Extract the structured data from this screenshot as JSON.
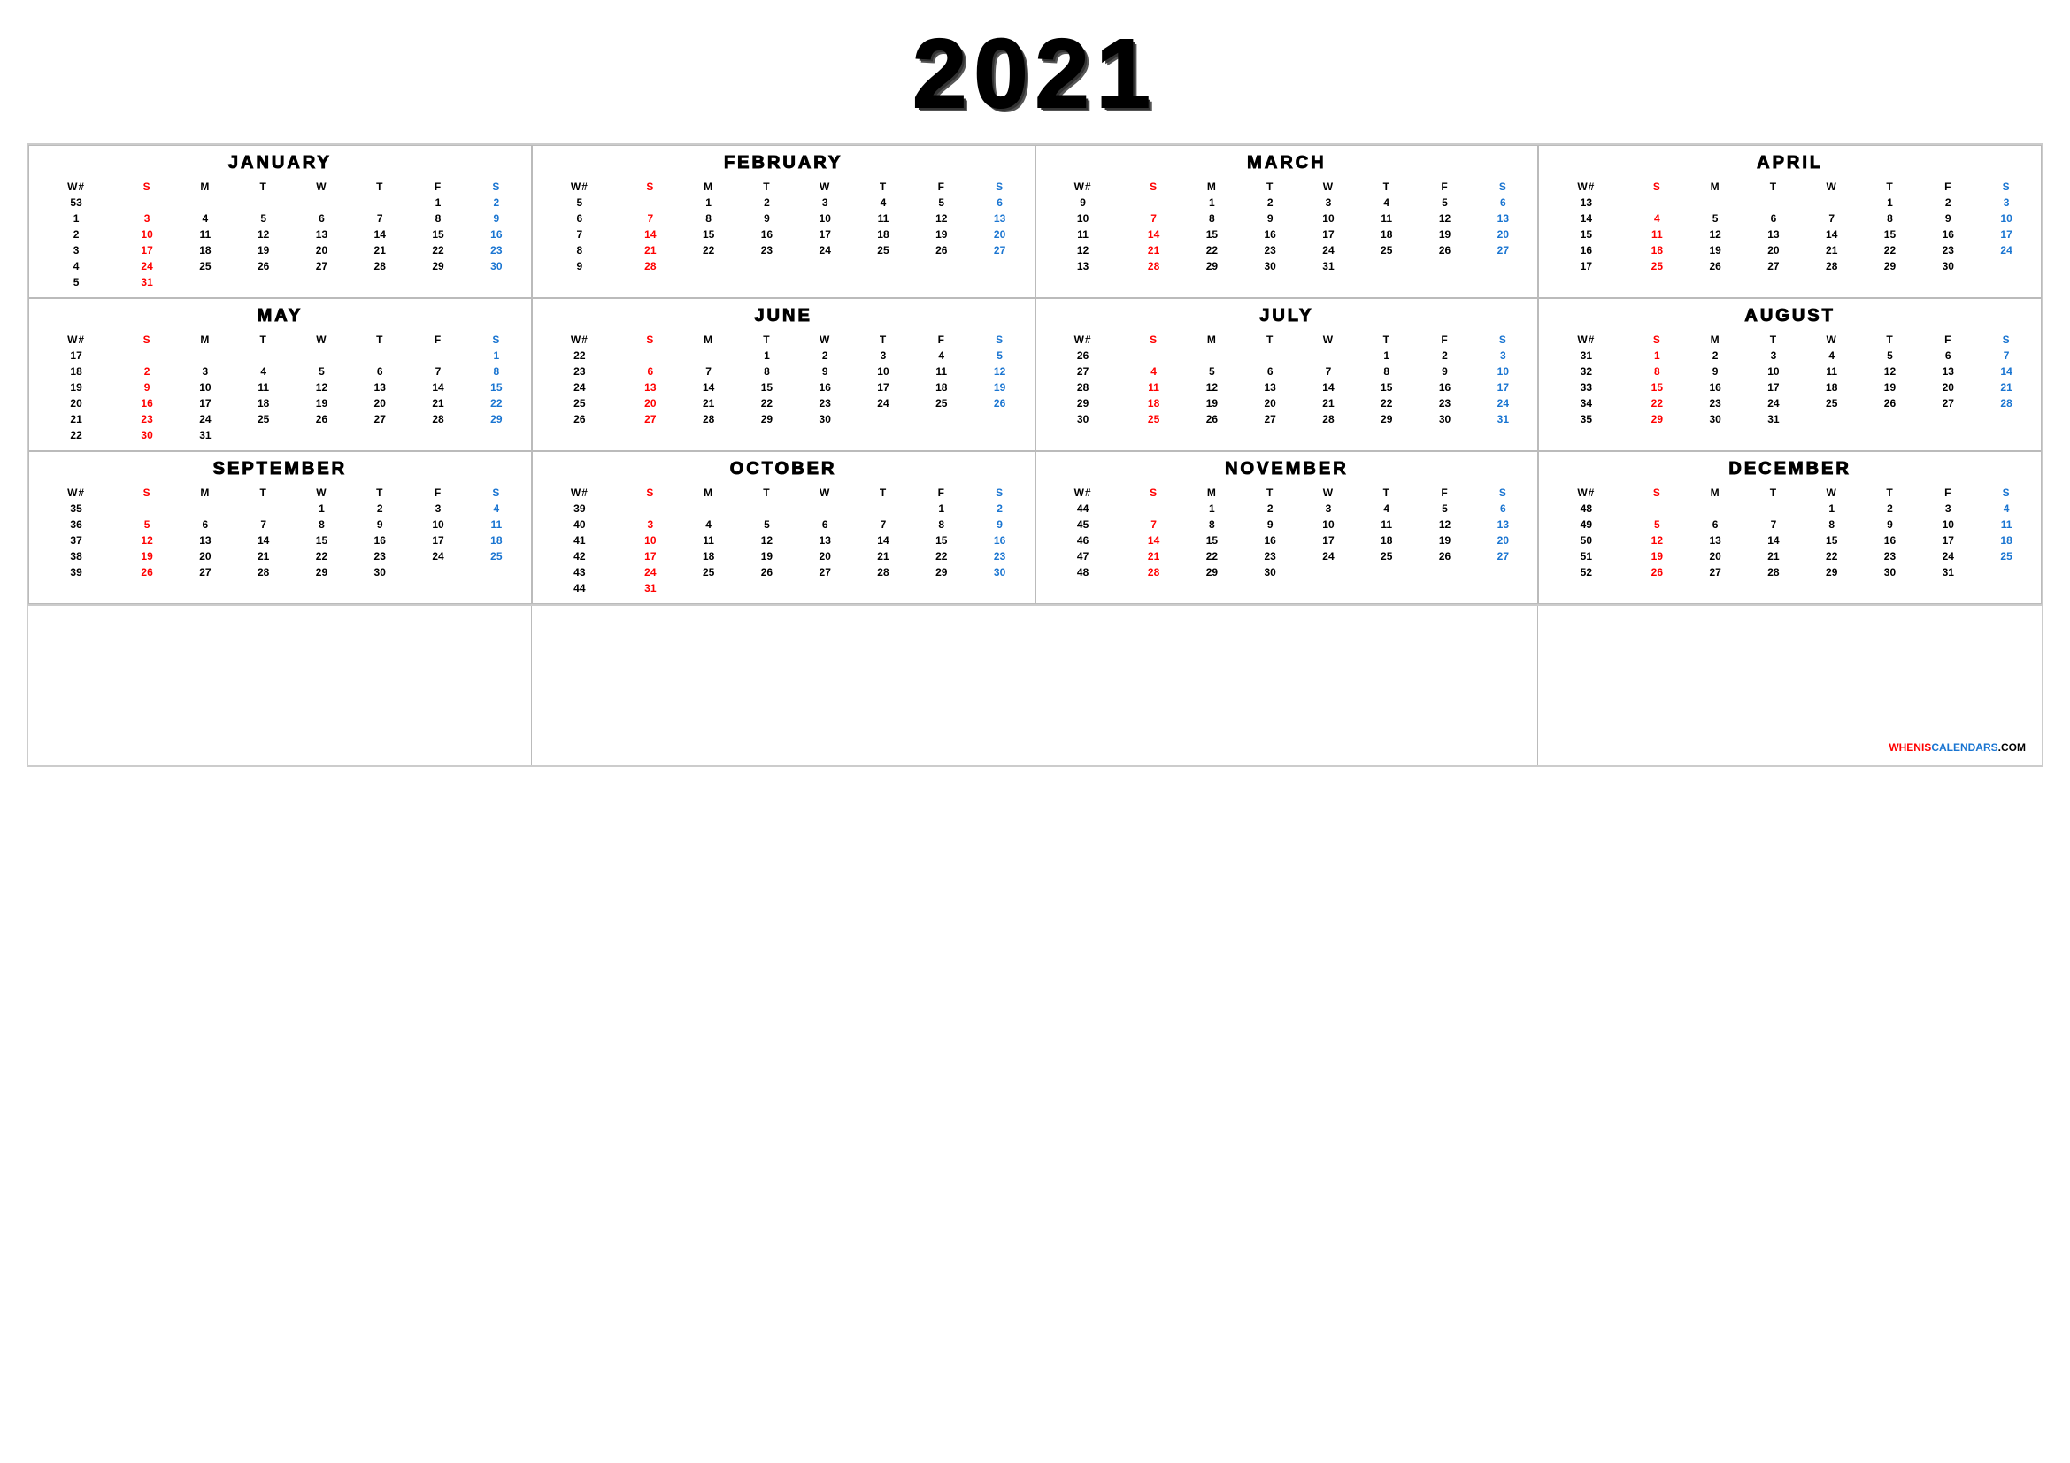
{
  "year": "2021",
  "months": [
    {
      "name": "JANUARY",
      "weeks": [
        {
          "wn": "53",
          "sun": "",
          "mon": "",
          "tue": "",
          "wed": "",
          "thu": "",
          "fri": "1",
          "sat": "2"
        },
        {
          "wn": "1",
          "sun": "3",
          "mon": "4",
          "tue": "5",
          "wed": "6",
          "thu": "7",
          "fri": "8",
          "sat": "9"
        },
        {
          "wn": "2",
          "sun": "10",
          "mon": "11",
          "tue": "12",
          "wed": "13",
          "thu": "14",
          "fri": "15",
          "sat": "16"
        },
        {
          "wn": "3",
          "sun": "17",
          "mon": "18",
          "tue": "19",
          "wed": "20",
          "thu": "21",
          "fri": "22",
          "sat": "23"
        },
        {
          "wn": "4",
          "sun": "24",
          "mon": "25",
          "tue": "26",
          "wed": "27",
          "thu": "28",
          "fri": "29",
          "sat": "30"
        },
        {
          "wn": "5",
          "sun": "31",
          "mon": "",
          "tue": "",
          "wed": "",
          "thu": "",
          "fri": "",
          "sat": ""
        }
      ]
    },
    {
      "name": "FEBRUARY",
      "weeks": [
        {
          "wn": "5",
          "sun": "",
          "mon": "1",
          "tue": "2",
          "wed": "3",
          "thu": "4",
          "fri": "5",
          "sat": "6"
        },
        {
          "wn": "6",
          "sun": "7",
          "mon": "8",
          "tue": "9",
          "wed": "10",
          "thu": "11",
          "fri": "12",
          "sat": "13"
        },
        {
          "wn": "7",
          "sun": "14",
          "mon": "15",
          "tue": "16",
          "wed": "17",
          "thu": "18",
          "fri": "19",
          "sat": "20"
        },
        {
          "wn": "8",
          "sun": "21",
          "mon": "22",
          "tue": "23",
          "wed": "24",
          "thu": "25",
          "fri": "26",
          "sat": "27"
        },
        {
          "wn": "9",
          "sun": "28",
          "mon": "",
          "tue": "",
          "wed": "",
          "thu": "",
          "fri": "",
          "sat": ""
        }
      ]
    },
    {
      "name": "MARCH",
      "weeks": [
        {
          "wn": "9",
          "sun": "",
          "mon": "1",
          "tue": "2",
          "wed": "3",
          "thu": "4",
          "fri": "5",
          "sat": "6"
        },
        {
          "wn": "10",
          "sun": "7",
          "mon": "8",
          "tue": "9",
          "wed": "10",
          "thu": "11",
          "fri": "12",
          "sat": "13"
        },
        {
          "wn": "11",
          "sun": "14",
          "mon": "15",
          "tue": "16",
          "wed": "17",
          "thu": "18",
          "fri": "19",
          "sat": "20"
        },
        {
          "wn": "12",
          "sun": "21",
          "mon": "22",
          "tue": "23",
          "wed": "24",
          "thu": "25",
          "fri": "26",
          "sat": "27"
        },
        {
          "wn": "13",
          "sun": "28",
          "mon": "29",
          "tue": "30",
          "wed": "31",
          "thu": "",
          "fri": "",
          "sat": ""
        }
      ]
    },
    {
      "name": "APRIL",
      "weeks": [
        {
          "wn": "13",
          "sun": "",
          "mon": "",
          "tue": "",
          "wed": "",
          "thu": "1",
          "fri": "2",
          "sat": "3"
        },
        {
          "wn": "14",
          "sun": "4",
          "mon": "5",
          "tue": "6",
          "wed": "7",
          "thu": "8",
          "fri": "9",
          "sat": "10"
        },
        {
          "wn": "15",
          "sun": "11",
          "mon": "12",
          "tue": "13",
          "wed": "14",
          "thu": "15",
          "fri": "16",
          "sat": "17"
        },
        {
          "wn": "16",
          "sun": "18",
          "mon": "19",
          "tue": "20",
          "wed": "21",
          "thu": "22",
          "fri": "23",
          "sat": "24"
        },
        {
          "wn": "17",
          "sun": "25",
          "mon": "26",
          "tue": "27",
          "wed": "28",
          "thu": "29",
          "fri": "30",
          "sat": ""
        }
      ]
    },
    {
      "name": "MAY",
      "weeks": [
        {
          "wn": "17",
          "sun": "",
          "mon": "",
          "tue": "",
          "wed": "",
          "thu": "",
          "fri": "",
          "sat": "1"
        },
        {
          "wn": "18",
          "sun": "2",
          "mon": "3",
          "tue": "4",
          "wed": "5",
          "thu": "6",
          "fri": "7",
          "sat": "8"
        },
        {
          "wn": "19",
          "sun": "9",
          "mon": "10",
          "tue": "11",
          "wed": "12",
          "thu": "13",
          "fri": "14",
          "sat": "15"
        },
        {
          "wn": "20",
          "sun": "16",
          "mon": "17",
          "tue": "18",
          "wed": "19",
          "thu": "20",
          "fri": "21",
          "sat": "22"
        },
        {
          "wn": "21",
          "sun": "23",
          "mon": "24",
          "tue": "25",
          "wed": "26",
          "thu": "27",
          "fri": "28",
          "sat": "29"
        },
        {
          "wn": "22",
          "sun": "30",
          "mon": "31",
          "tue": "",
          "wed": "",
          "thu": "",
          "fri": "",
          "sat": ""
        }
      ]
    },
    {
      "name": "JUNE",
      "weeks": [
        {
          "wn": "22",
          "sun": "",
          "mon": "",
          "tue": "1",
          "wed": "2",
          "thu": "3",
          "fri": "4",
          "sat": "5"
        },
        {
          "wn": "23",
          "sun": "6",
          "mon": "7",
          "tue": "8",
          "wed": "9",
          "thu": "10",
          "fri": "11",
          "sat": "12"
        },
        {
          "wn": "24",
          "sun": "13",
          "mon": "14",
          "tue": "15",
          "wed": "16",
          "thu": "17",
          "fri": "18",
          "sat": "19"
        },
        {
          "wn": "25",
          "sun": "20",
          "mon": "21",
          "tue": "22",
          "wed": "23",
          "thu": "24",
          "fri": "25",
          "sat": "26"
        },
        {
          "wn": "26",
          "sun": "27",
          "mon": "28",
          "tue": "29",
          "wed": "30",
          "thu": "",
          "fri": "",
          "sat": ""
        }
      ]
    },
    {
      "name": "JULY",
      "weeks": [
        {
          "wn": "26",
          "sun": "",
          "mon": "",
          "tue": "",
          "wed": "",
          "thu": "1",
          "fri": "2",
          "sat": "3"
        },
        {
          "wn": "27",
          "sun": "4",
          "mon": "5",
          "tue": "6",
          "wed": "7",
          "thu": "8",
          "fri": "9",
          "sat": "10"
        },
        {
          "wn": "28",
          "sun": "11",
          "mon": "12",
          "tue": "13",
          "wed": "14",
          "thu": "15",
          "fri": "16",
          "sat": "17"
        },
        {
          "wn": "29",
          "sun": "18",
          "mon": "19",
          "tue": "20",
          "wed": "21",
          "thu": "22",
          "fri": "23",
          "sat": "24"
        },
        {
          "wn": "30",
          "sun": "25",
          "mon": "26",
          "tue": "27",
          "wed": "28",
          "thu": "29",
          "fri": "30",
          "sat": "31"
        }
      ]
    },
    {
      "name": "AUGUST",
      "weeks": [
        {
          "wn": "31",
          "sun": "1",
          "mon": "2",
          "tue": "3",
          "wed": "4",
          "thu": "5",
          "fri": "6",
          "sat": "7"
        },
        {
          "wn": "32",
          "sun": "8",
          "mon": "9",
          "tue": "10",
          "wed": "11",
          "thu": "12",
          "fri": "13",
          "sat": "14"
        },
        {
          "wn": "33",
          "sun": "15",
          "mon": "16",
          "tue": "17",
          "wed": "18",
          "thu": "19",
          "fri": "20",
          "sat": "21"
        },
        {
          "wn": "34",
          "sun": "22",
          "mon": "23",
          "tue": "24",
          "wed": "25",
          "thu": "26",
          "fri": "27",
          "sat": "28"
        },
        {
          "wn": "35",
          "sun": "29",
          "mon": "30",
          "tue": "31",
          "wed": "",
          "thu": "",
          "fri": "",
          "sat": ""
        }
      ]
    },
    {
      "name": "SEPTEMBER",
      "weeks": [
        {
          "wn": "35",
          "sun": "",
          "mon": "",
          "tue": "",
          "wed": "1",
          "thu": "2",
          "fri": "3",
          "sat": "4"
        },
        {
          "wn": "36",
          "sun": "5",
          "mon": "6",
          "tue": "7",
          "wed": "8",
          "thu": "9",
          "fri": "10",
          "sat": "11"
        },
        {
          "wn": "37",
          "sun": "12",
          "mon": "13",
          "tue": "14",
          "wed": "15",
          "thu": "16",
          "fri": "17",
          "sat": "18"
        },
        {
          "wn": "38",
          "sun": "19",
          "mon": "20",
          "tue": "21",
          "wed": "22",
          "thu": "23",
          "fri": "24",
          "sat": "25"
        },
        {
          "wn": "39",
          "sun": "26",
          "mon": "27",
          "tue": "28",
          "wed": "29",
          "thu": "30",
          "fri": "",
          "sat": ""
        }
      ]
    },
    {
      "name": "OCTOBER",
      "weeks": [
        {
          "wn": "39",
          "sun": "",
          "mon": "",
          "tue": "",
          "wed": "",
          "thu": "",
          "fri": "1",
          "sat": "2"
        },
        {
          "wn": "40",
          "sun": "3",
          "mon": "4",
          "tue": "5",
          "wed": "6",
          "thu": "7",
          "fri": "8",
          "sat": "9"
        },
        {
          "wn": "41",
          "sun": "10",
          "mon": "11",
          "tue": "12",
          "wed": "13",
          "thu": "14",
          "fri": "15",
          "sat": "16"
        },
        {
          "wn": "42",
          "sun": "17",
          "mon": "18",
          "tue": "19",
          "wed": "20",
          "thu": "21",
          "fri": "22",
          "sat": "23"
        },
        {
          "wn": "43",
          "sun": "24",
          "mon": "25",
          "tue": "26",
          "wed": "27",
          "thu": "28",
          "fri": "29",
          "sat": "30"
        },
        {
          "wn": "44",
          "sun": "31",
          "mon": "",
          "tue": "",
          "wed": "",
          "thu": "",
          "fri": "",
          "sat": ""
        }
      ]
    },
    {
      "name": "NOVEMBER",
      "weeks": [
        {
          "wn": "44",
          "sun": "",
          "mon": "1",
          "tue": "2",
          "wed": "3",
          "thu": "4",
          "fri": "5",
          "sat": "6"
        },
        {
          "wn": "45",
          "sun": "7",
          "mon": "8",
          "tue": "9",
          "wed": "10",
          "thu": "11",
          "fri": "12",
          "sat": "13"
        },
        {
          "wn": "46",
          "sun": "14",
          "mon": "15",
          "tue": "16",
          "wed": "17",
          "thu": "18",
          "fri": "19",
          "sat": "20"
        },
        {
          "wn": "47",
          "sun": "21",
          "mon": "22",
          "tue": "23",
          "wed": "24",
          "thu": "25",
          "fri": "26",
          "sat": "27"
        },
        {
          "wn": "48",
          "sun": "28",
          "mon": "29",
          "tue": "30",
          "wed": "",
          "thu": "",
          "fri": "",
          "sat": ""
        }
      ]
    },
    {
      "name": "DECEMBER",
      "weeks": [
        {
          "wn": "48",
          "sun": "",
          "mon": "",
          "tue": "",
          "wed": "1",
          "thu": "2",
          "fri": "3",
          "sat": "4"
        },
        {
          "wn": "49",
          "sun": "5",
          "mon": "6",
          "tue": "7",
          "wed": "8",
          "thu": "9",
          "fri": "10",
          "sat": "11"
        },
        {
          "wn": "50",
          "sun": "12",
          "mon": "13",
          "tue": "14",
          "wed": "15",
          "thu": "16",
          "fri": "17",
          "sat": "18"
        },
        {
          "wn": "51",
          "sun": "19",
          "mon": "20",
          "tue": "21",
          "wed": "22",
          "thu": "23",
          "fri": "24",
          "sat": "25"
        },
        {
          "wn": "52",
          "sun": "26",
          "mon": "27",
          "tue": "28",
          "wed": "29",
          "thu": "30",
          "fri": "31",
          "sat": ""
        }
      ]
    }
  ],
  "headers": {
    "wn": "W#",
    "sun": "S",
    "mon": "M",
    "tue": "T",
    "wed": "W",
    "thu": "T",
    "fri": "F",
    "sat": "S"
  },
  "watermark": "WHENISCALENDARS.COM"
}
